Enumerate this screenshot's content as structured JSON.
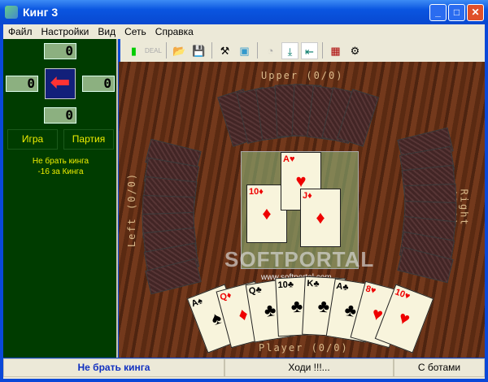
{
  "window": {
    "title": "Кинг 3"
  },
  "menu": [
    "Файл",
    "Настройки",
    "Вид",
    "Сеть",
    "Справка"
  ],
  "scores": {
    "top": "0",
    "left": "0",
    "right": "0",
    "bottom": "0"
  },
  "panel": {
    "tabs": [
      "Игра",
      "Партия"
    ],
    "info_line1": "Не брать кинга",
    "info_line2": "-16 за Кинга"
  },
  "toolbar": {
    "icons": [
      "new-game-icon",
      "deal-icon",
      "open-icon",
      "save-icon",
      "tools-icon",
      "picture-icon",
      "timer-icon",
      "download-icon",
      "import-icon",
      "calendar-icon",
      "settings-icon"
    ]
  },
  "table": {
    "upper_label": "Upper (0/0)",
    "left_label": "Left (0/0)",
    "right_label": "Right (0/0)",
    "player_label": "Player (0/0)",
    "center_cards": [
      {
        "rank": "10",
        "suit": "♦",
        "color": "red"
      },
      {
        "rank": "A",
        "suit": "♥",
        "color": "red"
      },
      {
        "rank": "J",
        "suit": "♦",
        "color": "red"
      }
    ],
    "player_cards": [
      {
        "rank": "A",
        "suit": "♠",
        "color": "blk"
      },
      {
        "rank": "Q",
        "suit": "♦",
        "color": "red"
      },
      {
        "rank": "Q",
        "suit": "♣",
        "color": "blk"
      },
      {
        "rank": "10",
        "suit": "♣",
        "color": "blk"
      },
      {
        "rank": "K",
        "suit": "♣",
        "color": "blk"
      },
      {
        "rank": "A",
        "suit": "♣",
        "color": "blk"
      },
      {
        "rank": "8",
        "suit": "♥",
        "color": "red"
      },
      {
        "rank": "10",
        "suit": "♥",
        "color": "red"
      }
    ],
    "watermark": "SOFTPORTAL",
    "watermark_url": "www.softportal.com"
  },
  "status": {
    "game": "Не брать кинга",
    "turn": "Ходи !!!...",
    "mode": "С ботами"
  }
}
